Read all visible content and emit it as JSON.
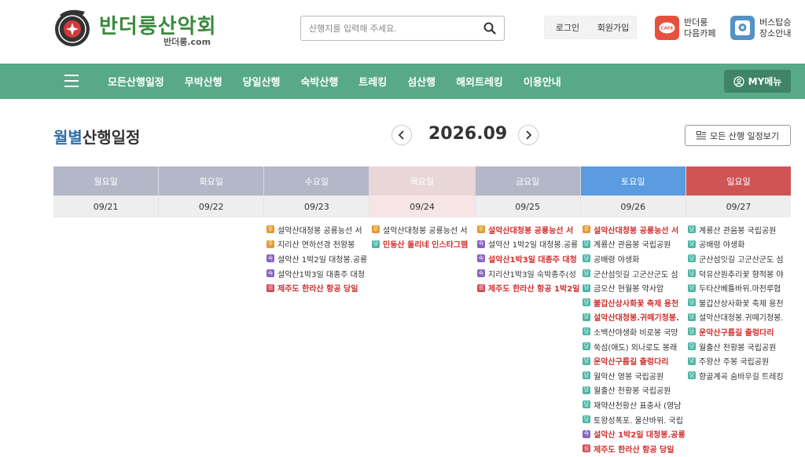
{
  "header": {
    "brand": "반더룽산악회",
    "brand_domain": "반더룽.com",
    "search_placeholder": "산행지를 입력해 주세요.",
    "login": "로그인",
    "signup": "회원가입",
    "quick": [
      {
        "line1": "반더룽",
        "line2": "다음카페",
        "icon": "cafe-icon",
        "badge": "CAFE",
        "color": "#e7503f"
      },
      {
        "line1": "버스탑승",
        "line2": "장소안내",
        "icon": "bus-stop-location-icon",
        "color": "#5292c6"
      }
    ]
  },
  "nav": {
    "items": [
      "모든산행일정",
      "무박산행",
      "당일산행",
      "숙박산행",
      "트레킹",
      "섬산행",
      "해외트레킹",
      "이용안내"
    ],
    "my_menu": "MY메뉴"
  },
  "page": {
    "title_accent": "월별",
    "title_rest": "산행일정",
    "month": "2026.09",
    "all_button": "모든 산행 일정보기"
  },
  "calendar": {
    "days": [
      {
        "label": "월요일",
        "date": "09/21",
        "head_color": "#b3b7c8",
        "date_bg": "#eeeeee"
      },
      {
        "label": "화요일",
        "date": "09/22",
        "head_color": "#b3b7c8",
        "date_bg": "#eeeeee"
      },
      {
        "label": "수요일",
        "date": "09/23",
        "head_color": "#b3b7c8",
        "date_bg": "#eeeeee"
      },
      {
        "label": "목요일",
        "date": "09/24",
        "head_color": "#e9d7d7",
        "date_bg": "#f7e5e5",
        "today": true
      },
      {
        "label": "금요일",
        "date": "09/25",
        "head_color": "#b3b7c8",
        "date_bg": "#eeeeee"
      },
      {
        "label": "토요일",
        "date": "09/26",
        "head_color": "#5b9be0",
        "date_bg": "#eeeeee"
      },
      {
        "label": "일요일",
        "date": "09/27",
        "head_color": "#cf5555",
        "date_bg": "#eeeeee"
      }
    ],
    "events": [
      [],
      [],
      [
        {
          "type": "무",
          "text": "설악산대청봉 공룡능선 서",
          "hl": false
        },
        {
          "type": "무",
          "text": "지리산 연하선경 천왕봉",
          "hl": false
        },
        {
          "type": "숙",
          "text": "설악산 1박2일 대청봉.공룡",
          "hl": false
        },
        {
          "type": "숙",
          "text": "설악산1박3일 대종주 대청",
          "hl": false
        },
        {
          "type": "섬",
          "text": "제주도 한라산 항공 당일",
          "hl": true
        }
      ],
      [
        {
          "type": "무",
          "text": "설악산대청봉 공룡능선 서",
          "hl": false
        },
        {
          "type": "당",
          "text": "민둥산 돌리네 인스타그램",
          "hl": true
        }
      ],
      [
        {
          "type": "무",
          "text": "설악산대청봉 공룡능선 서",
          "hl": true
        },
        {
          "type": "숙",
          "text": "설악산 1박2일 대청봉.공룡",
          "hl": false
        },
        {
          "type": "숙",
          "text": "설악산1박3일 대종주 대청",
          "hl": true
        },
        {
          "type": "숙",
          "text": "지리산1박3일 숙박종주(성",
          "hl": false
        },
        {
          "type": "섬",
          "text": "제주도 한라산 항공 1박2일",
          "hl": true
        }
      ],
      [
        {
          "type": "무",
          "text": "설악산대청봉 공룡능선 서",
          "hl": true
        },
        {
          "type": "당",
          "text": "계룡산 관음봉 국립공원",
          "hl": false
        },
        {
          "type": "당",
          "text": "공배령 야생화",
          "hl": false
        },
        {
          "type": "당",
          "text": "군산섬잇길 고군산군도 섬",
          "hl": false
        },
        {
          "type": "당",
          "text": "금오산 현월봉 약사암",
          "hl": false
        },
        {
          "type": "당",
          "text": "불갑산상사화꽃 축제 용천",
          "hl": true
        },
        {
          "type": "당",
          "text": "설악산대청봉.귀떼기청봉.",
          "hl": true
        },
        {
          "type": "당",
          "text": "소백산야생화 비로봉 국망",
          "hl": false
        },
        {
          "type": "당",
          "text": "쑥섬(애도) 외나로도 봉래",
          "hl": false
        },
        {
          "type": "당",
          "text": "운악산구름길 출렁다리",
          "hl": true
        },
        {
          "type": "당",
          "text": "월악산 영봉 국립공원",
          "hl": false
        },
        {
          "type": "당",
          "text": "월출산 천황봉 국립공원",
          "hl": false
        },
        {
          "type": "당",
          "text": "재약산천황산 표충사 (영남",
          "hl": false
        },
        {
          "type": "당",
          "text": "토왕성폭포. 울산바위. 국립",
          "hl": false
        },
        {
          "type": "숙",
          "text": "설악산 1박2일 대청봉.공룡",
          "hl": true
        },
        {
          "type": "섬",
          "text": "제주도 한라산 항공 당일",
          "hl": true
        }
      ],
      [
        {
          "type": "당",
          "text": "계룡산 관음봉 국립공원",
          "hl": false
        },
        {
          "type": "당",
          "text": "공배령 야생화",
          "hl": false
        },
        {
          "type": "당",
          "text": "군산섬잇길 고군산군도 섬",
          "hl": false
        },
        {
          "type": "당",
          "text": "덕유산원추리꽃 향적봉 야",
          "hl": false
        },
        {
          "type": "당",
          "text": "두타산베틀바위.마천루협",
          "hl": false
        },
        {
          "type": "당",
          "text": "불갑산상사화꽃 축제 용천",
          "hl": false
        },
        {
          "type": "당",
          "text": "설악산대청봉.귀떼기청봉.",
          "hl": false
        },
        {
          "type": "당",
          "text": "운악산구름길 출렁다리",
          "hl": true
        },
        {
          "type": "당",
          "text": "월출산 천황봉 국립공원",
          "hl": false
        },
        {
          "type": "당",
          "text": "주왕산 주봉 국립공원",
          "hl": false
        },
        {
          "type": "당",
          "text": "향골계곡 숨바우길 트레킹",
          "hl": false
        }
      ]
    ]
  }
}
